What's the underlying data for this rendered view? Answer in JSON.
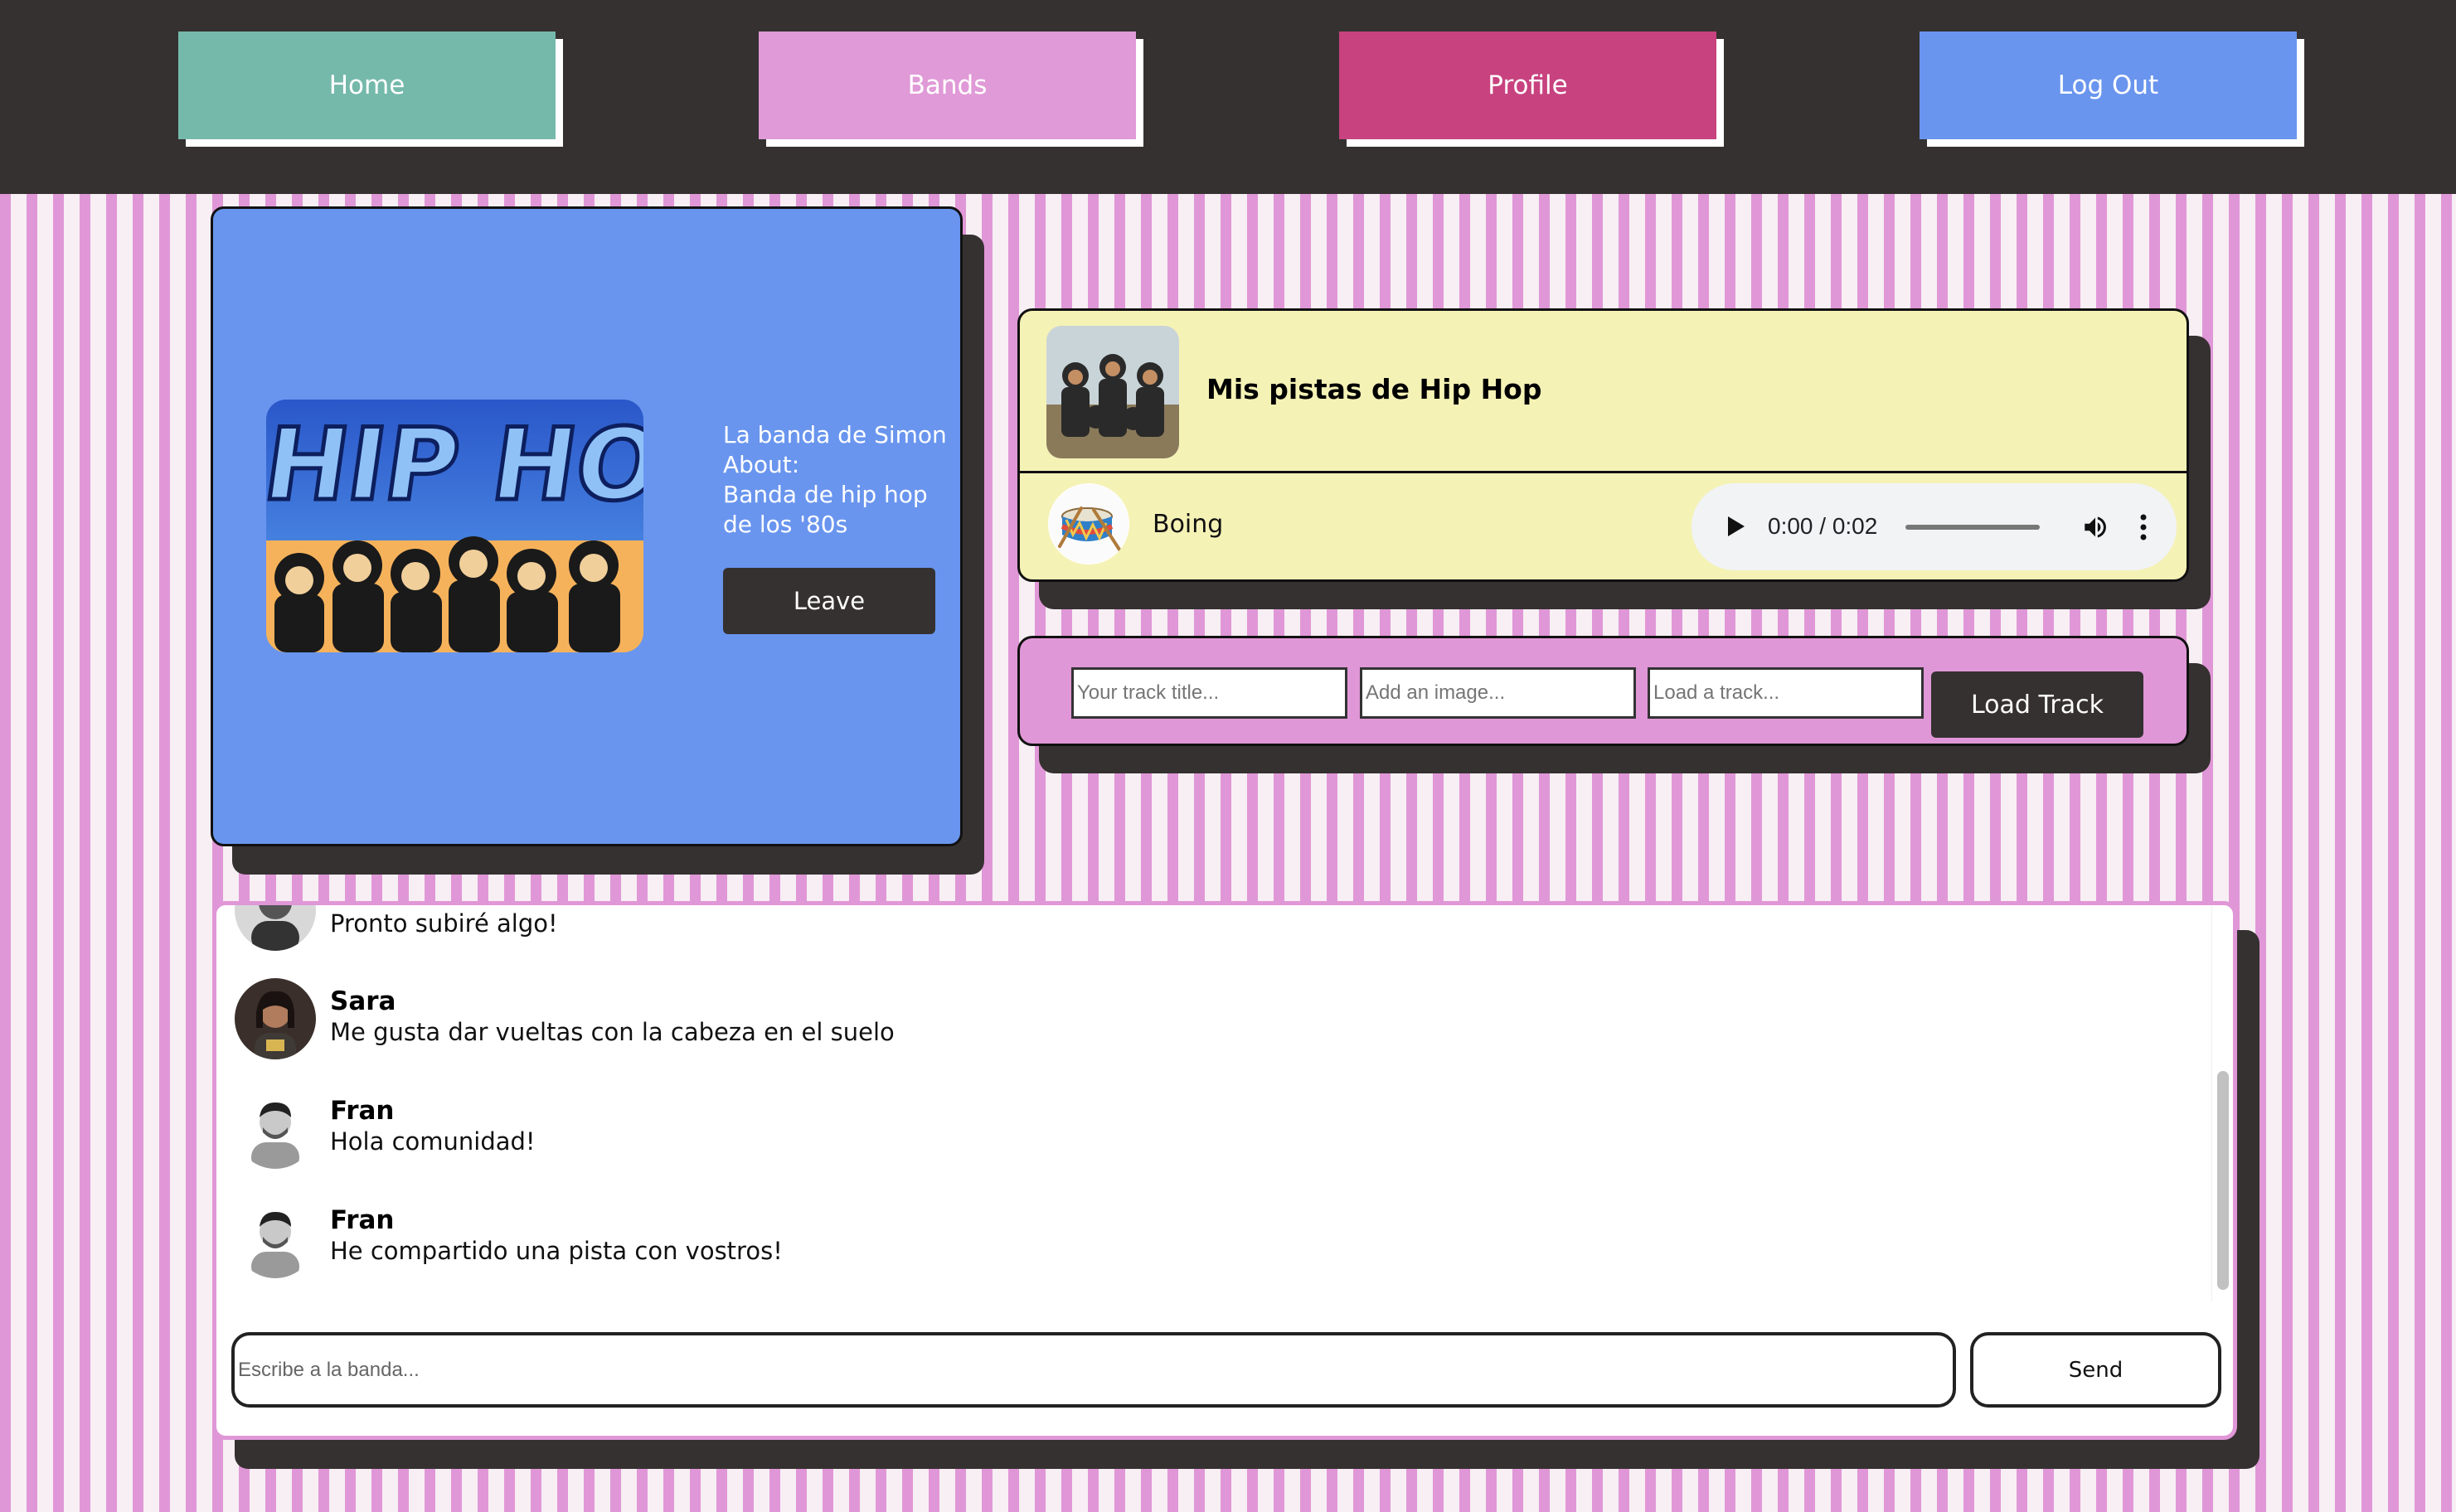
{
  "nav": {
    "home": "Home",
    "bands": "Bands",
    "profile": "Profile",
    "logout": "Log Out"
  },
  "colors": {
    "home": "#75b9ab",
    "bands": "#e09ad7",
    "profile": "#c7427f",
    "logout": "#6995ee",
    "dark": "#353130",
    "band_card": "#6995ee",
    "tracks_card": "#f5f2b6",
    "upload_card": "#e097d7"
  },
  "band": {
    "name": "La banda de Simon",
    "about_label": "About:",
    "description": "Banda de hip hop de los '80s",
    "leave_label": "Leave",
    "image_icon": "hip-hop-artwork-image"
  },
  "tracks": {
    "playlist_title": "Mis pistas de Hip Hop",
    "track_name": "Boing",
    "track_icon": "drum-icon",
    "player_time": "0:00 / 0:02"
  },
  "upload": {
    "title_placeholder": "Your track title...",
    "image_placeholder": "Add an image...",
    "track_placeholder": "Load a track...",
    "load_label": "Load Track"
  },
  "chat": {
    "messages": [
      {
        "name": "",
        "text": "Pronto subiré algo!"
      },
      {
        "name": "Sara",
        "text": "Me gusta dar vueltas con la cabeza en el suelo"
      },
      {
        "name": "Fran",
        "text": "Hola comunidad!"
      },
      {
        "name": "Fran",
        "text": "He compartido una pista con vostros!"
      }
    ],
    "input_placeholder": "Escribe a la banda...",
    "send_label": "Send"
  }
}
